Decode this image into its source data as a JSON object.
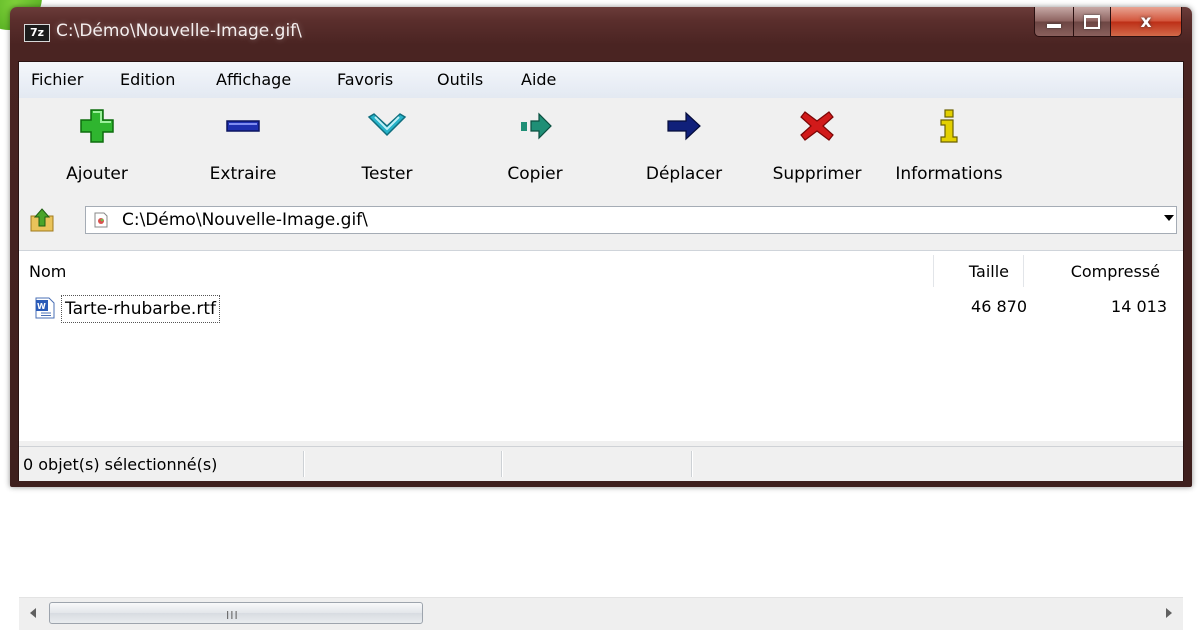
{
  "window": {
    "title": "C:\\Démo\\Nouvelle-Image.gif\\",
    "app_icon_text": "7z"
  },
  "menu": [
    "Fichier",
    "Edition",
    "Affichage",
    "Favoris",
    "Outils",
    "Aide"
  ],
  "toolbar": [
    {
      "label": "Ajouter",
      "icon": "plus-icon"
    },
    {
      "label": "Extraire",
      "icon": "minus-icon"
    },
    {
      "label": "Tester",
      "icon": "check-chevron-icon"
    },
    {
      "label": "Copier",
      "icon": "double-arrow-right-icon"
    },
    {
      "label": "Déplacer",
      "icon": "arrow-right-icon"
    },
    {
      "label": "Supprimer",
      "icon": "delete-x-icon"
    },
    {
      "label": "Informations",
      "icon": "info-icon"
    }
  ],
  "address": {
    "path": "C:\\Démo\\Nouvelle-Image.gif\\"
  },
  "list": {
    "columns": [
      "Nom",
      "Taille",
      "Compressé"
    ],
    "rows": [
      {
        "name": "Tarte-rhubarbe.rtf",
        "size": "46 870",
        "compressed": "14 013"
      }
    ]
  },
  "scrollbar": {
    "grip": "III"
  },
  "status": {
    "selection": "0 objet(s) sélectionné(s)"
  },
  "colors": {
    "title_bar": "#4a2422",
    "add_green": "#2fb52f",
    "extract_blue": "#1e2fb0",
    "test_cyan": "#27b3c9",
    "copy_teal": "#1f8f76",
    "move_navy": "#10207a",
    "delete_red": "#d11a1a",
    "info_yellow": "#e3d000"
  }
}
